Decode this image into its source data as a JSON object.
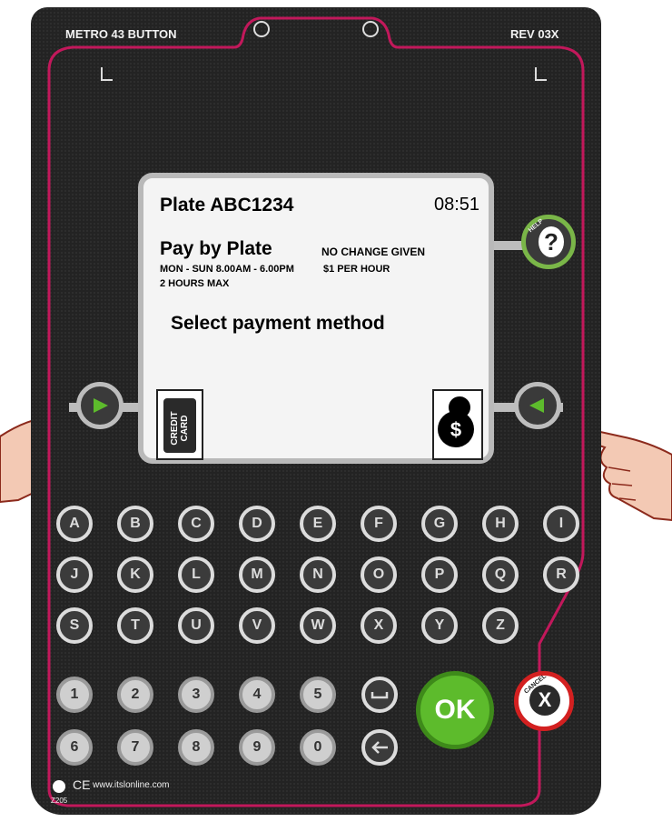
{
  "device": {
    "model": "METRO 43 BUTTON",
    "revision": "REV 03X",
    "website": "www.itslonline.com",
    "code": "Z205",
    "ce_mark": "CE"
  },
  "screen": {
    "plate_line": "Plate ABC1234",
    "time": "08:51",
    "mode": "Pay by Plate",
    "change_note": "NO CHANGE GIVEN",
    "hours": "MON - SUN  8.00AM - 6.00PM",
    "rate": "$1 PER HOUR",
    "max": "2 HOURS MAX",
    "prompt": "Select payment method",
    "credit_card_label": "CREDIT CARD"
  },
  "buttons": {
    "help_label": "HELP",
    "ok_label": "OK",
    "cancel_label": "CANCEL"
  },
  "keys": {
    "row1": [
      "A",
      "B",
      "C",
      "D",
      "E",
      "F",
      "G",
      "H",
      "I"
    ],
    "row2": [
      "J",
      "K",
      "L",
      "M",
      "N",
      "O",
      "P",
      "Q",
      "R"
    ],
    "row3": [
      "S",
      "T",
      "U",
      "V",
      "W",
      "X",
      "Y",
      "Z"
    ],
    "row4": [
      "1",
      "2",
      "3",
      "4",
      "5"
    ],
    "row5": [
      "6",
      "7",
      "8",
      "9",
      "0"
    ]
  },
  "colors": {
    "panel": "#232323",
    "trim": "#c2185b",
    "ok": "#5dbb2c",
    "cancel": "#d32020"
  }
}
